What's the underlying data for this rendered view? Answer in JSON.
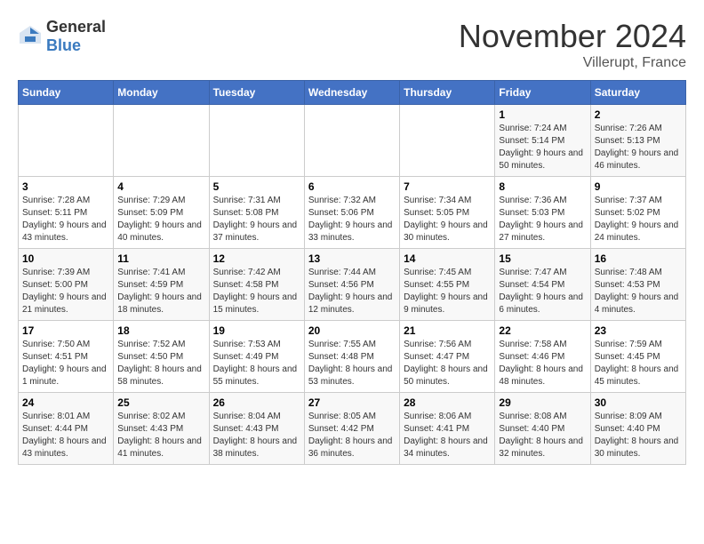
{
  "header": {
    "logo_general": "General",
    "logo_blue": "Blue",
    "month": "November 2024",
    "location": "Villerupt, France"
  },
  "weekdays": [
    "Sunday",
    "Monday",
    "Tuesday",
    "Wednesday",
    "Thursday",
    "Friday",
    "Saturday"
  ],
  "weeks": [
    [
      {
        "day": "",
        "info": ""
      },
      {
        "day": "",
        "info": ""
      },
      {
        "day": "",
        "info": ""
      },
      {
        "day": "",
        "info": ""
      },
      {
        "day": "",
        "info": ""
      },
      {
        "day": "1",
        "info": "Sunrise: 7:24 AM\nSunset: 5:14 PM\nDaylight: 9 hours and 50 minutes."
      },
      {
        "day": "2",
        "info": "Sunrise: 7:26 AM\nSunset: 5:13 PM\nDaylight: 9 hours and 46 minutes."
      }
    ],
    [
      {
        "day": "3",
        "info": "Sunrise: 7:28 AM\nSunset: 5:11 PM\nDaylight: 9 hours and 43 minutes."
      },
      {
        "day": "4",
        "info": "Sunrise: 7:29 AM\nSunset: 5:09 PM\nDaylight: 9 hours and 40 minutes."
      },
      {
        "day": "5",
        "info": "Sunrise: 7:31 AM\nSunset: 5:08 PM\nDaylight: 9 hours and 37 minutes."
      },
      {
        "day": "6",
        "info": "Sunrise: 7:32 AM\nSunset: 5:06 PM\nDaylight: 9 hours and 33 minutes."
      },
      {
        "day": "7",
        "info": "Sunrise: 7:34 AM\nSunset: 5:05 PM\nDaylight: 9 hours and 30 minutes."
      },
      {
        "day": "8",
        "info": "Sunrise: 7:36 AM\nSunset: 5:03 PM\nDaylight: 9 hours and 27 minutes."
      },
      {
        "day": "9",
        "info": "Sunrise: 7:37 AM\nSunset: 5:02 PM\nDaylight: 9 hours and 24 minutes."
      }
    ],
    [
      {
        "day": "10",
        "info": "Sunrise: 7:39 AM\nSunset: 5:00 PM\nDaylight: 9 hours and 21 minutes."
      },
      {
        "day": "11",
        "info": "Sunrise: 7:41 AM\nSunset: 4:59 PM\nDaylight: 9 hours and 18 minutes."
      },
      {
        "day": "12",
        "info": "Sunrise: 7:42 AM\nSunset: 4:58 PM\nDaylight: 9 hours and 15 minutes."
      },
      {
        "day": "13",
        "info": "Sunrise: 7:44 AM\nSunset: 4:56 PM\nDaylight: 9 hours and 12 minutes."
      },
      {
        "day": "14",
        "info": "Sunrise: 7:45 AM\nSunset: 4:55 PM\nDaylight: 9 hours and 9 minutes."
      },
      {
        "day": "15",
        "info": "Sunrise: 7:47 AM\nSunset: 4:54 PM\nDaylight: 9 hours and 6 minutes."
      },
      {
        "day": "16",
        "info": "Sunrise: 7:48 AM\nSunset: 4:53 PM\nDaylight: 9 hours and 4 minutes."
      }
    ],
    [
      {
        "day": "17",
        "info": "Sunrise: 7:50 AM\nSunset: 4:51 PM\nDaylight: 9 hours and 1 minute."
      },
      {
        "day": "18",
        "info": "Sunrise: 7:52 AM\nSunset: 4:50 PM\nDaylight: 8 hours and 58 minutes."
      },
      {
        "day": "19",
        "info": "Sunrise: 7:53 AM\nSunset: 4:49 PM\nDaylight: 8 hours and 55 minutes."
      },
      {
        "day": "20",
        "info": "Sunrise: 7:55 AM\nSunset: 4:48 PM\nDaylight: 8 hours and 53 minutes."
      },
      {
        "day": "21",
        "info": "Sunrise: 7:56 AM\nSunset: 4:47 PM\nDaylight: 8 hours and 50 minutes."
      },
      {
        "day": "22",
        "info": "Sunrise: 7:58 AM\nSunset: 4:46 PM\nDaylight: 8 hours and 48 minutes."
      },
      {
        "day": "23",
        "info": "Sunrise: 7:59 AM\nSunset: 4:45 PM\nDaylight: 8 hours and 45 minutes."
      }
    ],
    [
      {
        "day": "24",
        "info": "Sunrise: 8:01 AM\nSunset: 4:44 PM\nDaylight: 8 hours and 43 minutes."
      },
      {
        "day": "25",
        "info": "Sunrise: 8:02 AM\nSunset: 4:43 PM\nDaylight: 8 hours and 41 minutes."
      },
      {
        "day": "26",
        "info": "Sunrise: 8:04 AM\nSunset: 4:43 PM\nDaylight: 8 hours and 38 minutes."
      },
      {
        "day": "27",
        "info": "Sunrise: 8:05 AM\nSunset: 4:42 PM\nDaylight: 8 hours and 36 minutes."
      },
      {
        "day": "28",
        "info": "Sunrise: 8:06 AM\nSunset: 4:41 PM\nDaylight: 8 hours and 34 minutes."
      },
      {
        "day": "29",
        "info": "Sunrise: 8:08 AM\nSunset: 4:40 PM\nDaylight: 8 hours and 32 minutes."
      },
      {
        "day": "30",
        "info": "Sunrise: 8:09 AM\nSunset: 4:40 PM\nDaylight: 8 hours and 30 minutes."
      }
    ]
  ]
}
